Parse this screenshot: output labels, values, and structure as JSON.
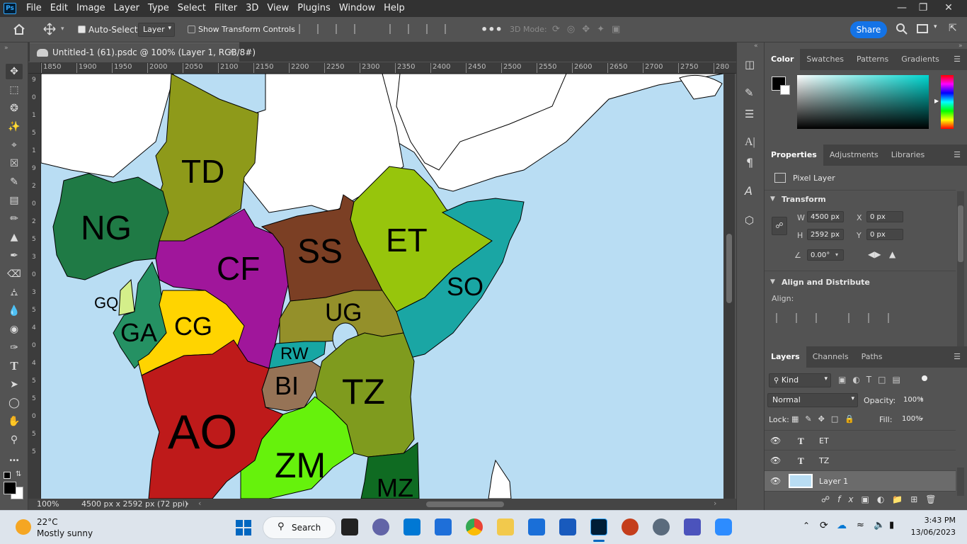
{
  "menu": [
    "File",
    "Edit",
    "Image",
    "Layer",
    "Type",
    "Select",
    "Filter",
    "3D",
    "View",
    "Plugins",
    "Window",
    "Help"
  ],
  "options": {
    "auto_select_label": "Auto-Select:",
    "auto_select_value": "Layer",
    "show_transform": "Show Transform Controls",
    "mode_3d": "3D Mode:",
    "share": "Share"
  },
  "document": {
    "tab_title": "Untitled-1 (61).psdc @ 100% (Layer 1, RGB/8#)"
  },
  "ruler": {
    "marks": [
      "1850",
      "1900",
      "1950",
      "2000",
      "2050",
      "2100",
      "2150",
      "2200",
      "2250",
      "2300",
      "2350",
      "2400",
      "2450",
      "2500",
      "2550",
      "2600",
      "2650",
      "2700",
      "2750",
      "280"
    ],
    "v_marks": [
      "9",
      "0",
      "1",
      "5",
      "1",
      "9",
      "2",
      "0",
      "2",
      "5",
      "3",
      "0",
      "3",
      "5",
      "4",
      "0",
      "4",
      "5",
      "5",
      "0",
      "5",
      "5"
    ]
  },
  "map_labels": [
    {
      "code": "TD",
      "size": "large"
    },
    {
      "code": "NG",
      "size": "large"
    },
    {
      "code": "CF",
      "size": "large"
    },
    {
      "code": "SS",
      "size": "large"
    },
    {
      "code": "ET",
      "size": "large"
    },
    {
      "code": "SO",
      "size": "medium"
    },
    {
      "code": "UG",
      "size": "medium"
    },
    {
      "code": "GQ",
      "size": "small"
    },
    {
      "code": "GA",
      "size": "medium"
    },
    {
      "code": "CG",
      "size": "medium"
    },
    {
      "code": "RW",
      "size": "small"
    },
    {
      "code": "BI",
      "size": "medium"
    },
    {
      "code": "TZ",
      "size": "large"
    },
    {
      "code": "AO",
      "size": "xlarge"
    },
    {
      "code": "ZM",
      "size": "large"
    },
    {
      "code": "MZ",
      "size": "medium"
    }
  ],
  "status": {
    "zoom": "100%",
    "doc_size": "4500 px x 2592 px (72 ppi)"
  },
  "color_panel": {
    "tabs": [
      "Color",
      "Swatches",
      "Patterns",
      "Gradients"
    ]
  },
  "properties": {
    "tabs": [
      "Properties",
      "Adjustments",
      "Libraries"
    ],
    "type": "Pixel Layer",
    "transform_title": "Transform",
    "w_label": "W",
    "w": "4500 px",
    "x_label": "X",
    "x": "0 px",
    "h_label": "H",
    "h": "2592 px",
    "y_label": "Y",
    "y": "0 px",
    "angle": "0.00°",
    "align_title": "Align and Distribute",
    "align_label": "Align:"
  },
  "layers_panel": {
    "tabs": [
      "Layers",
      "Channels",
      "Paths"
    ],
    "kind": "Kind",
    "blend": "Normal",
    "opacity_label": "Opacity:",
    "opacity": "100%",
    "lock_label": "Lock:",
    "fill_label": "Fill:",
    "fill": "100%",
    "layers": [
      {
        "name": "ET",
        "type": "text"
      },
      {
        "name": "TZ",
        "type": "text"
      },
      {
        "name": "Layer 1",
        "type": "pixel"
      }
    ]
  },
  "taskbar": {
    "temp": "22°C",
    "weather": "Mostly sunny",
    "search": "Search",
    "time": "3:43 PM",
    "date": "13/06/2023"
  },
  "colors": {
    "accent": "#1473e6",
    "panel": "#535353",
    "dark": "#323232"
  }
}
